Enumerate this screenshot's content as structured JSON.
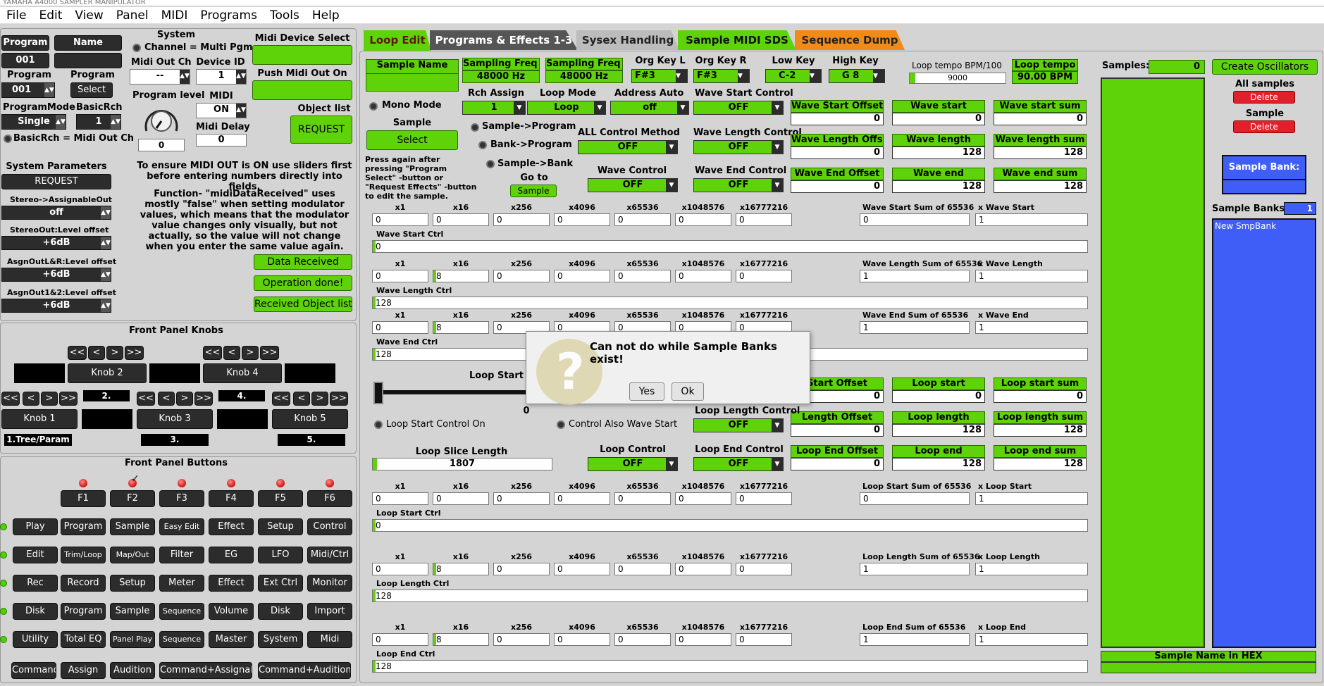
{
  "window_title": "YAMAHA A4000 SAMPLER MANIPULATOR",
  "menu": [
    "File",
    "Edit",
    "View",
    "Panel",
    "MIDI",
    "Programs",
    "Tools",
    "Help"
  ],
  "left": {
    "program_label": "Program",
    "program_value": "001",
    "name_label": "Name",
    "name_value": "",
    "program2_label": "Program",
    "program2_value": "001",
    "program_select_label": "Program",
    "select_button": "Select",
    "programmode_label": "ProgramMode",
    "programmode_value": "Single",
    "basicrch_label": "BasicRch",
    "basicrch_value": "1",
    "basicrch_radio": "BasicRch = Midi Out Ch",
    "system_label": "System",
    "channel_radio": "Channel = Multi Pgm",
    "midi_out_ch_label": "Midi Out Ch",
    "midi_out_ch_value": "--",
    "device_id_label": "Device ID",
    "device_id_value": "1",
    "program_level_label": "Program level",
    "program_level_value": "0",
    "midi_label": "MIDI",
    "midi_value": "ON",
    "midi_delay_label": "Midi Delay",
    "midi_delay_value": "0",
    "midi_device_select": "Midi Device Select",
    "push_midi_out": "Push Midi Out On",
    "object_list": "Object list",
    "request": "REQUEST",
    "system_params": "System Parameters",
    "request2": "REQUEST",
    "stereo_assign_label": "Stereo->AssignableOut",
    "stereo_assign_value": "off",
    "stereo_level_label": "StereoOut:Level offset",
    "stereo_level_value": "+6dB",
    "asgn_lr_label": "AsgnOutL&R:Level offset",
    "asgn_lr_value": "+6dB",
    "asgn_12_label": "AsgnOut1&2:Level offset",
    "asgn_12_value": "+6dB",
    "note1": "To ensure MIDI OUT is ON use sliders first before entering numbers directly into fields.",
    "note2": "Function- \"midiDataReceived\" uses mostly \"false\" when setting modulator values, which means that the modulator value changes only visually, but not actually, so the value will not change when you enter the same value again.",
    "data_received": "Data Received",
    "operation_done": "Operation done!",
    "received_object_list": "Received Object list"
  },
  "knobs": {
    "title": "Front Panel Knobs",
    "nav": [
      "<<",
      "<",
      ">",
      ">>"
    ],
    "knob2": "Knob 2",
    "knob4": "Knob 4",
    "knob1": "Knob 1",
    "knob3": "Knob 3",
    "knob5": "Knob 5",
    "l2": "2.",
    "l4": "4.",
    "l1": "1.Tree/Param",
    "l3": "3.",
    "l5": "5."
  },
  "buttons": {
    "title": "Front Panel Buttons",
    "f": [
      "F1",
      "F2",
      "F3",
      "F4",
      "F5",
      "F6"
    ],
    "rows": [
      [
        "Play",
        "Program",
        "Sample",
        "Easy Edit",
        "Effect",
        "Setup",
        "Control"
      ],
      [
        "Edit",
        "Trim/Loop",
        "Map/Out",
        "Filter",
        "EG",
        "LFO",
        "Midi/Ctrl"
      ],
      [
        "Rec",
        "Record",
        "Setup",
        "Meter",
        "Effect",
        "Ext Ctrl",
        "Monitor"
      ],
      [
        "Disk",
        "Program",
        "Sample",
        "Sequence",
        "Volume",
        "Disk",
        "Import"
      ],
      [
        "Utility",
        "Total EQ",
        "Panel Play",
        "Sequence",
        "Master",
        "System",
        "Midi"
      ]
    ],
    "bottom": [
      "Command",
      "Assign",
      "Audition",
      "Command+Assignable",
      "Command+Audition"
    ]
  },
  "tabs": [
    "Loop Edit",
    "Programs & Effects 1-3",
    "Sysex Handling",
    "Sample MIDI SDS",
    "Sequence Dump"
  ],
  "loop": {
    "sample_name": "Sample Name",
    "sf_l": "Sampling Freq L",
    "sf_l_v": "48000 Hz",
    "sf_r": "Sampling Freq R",
    "sf_r_v": "48000 Hz",
    "org_l": "Org Key L",
    "org_l_v": "F#3",
    "org_r": "Org Key R",
    "org_r_v": "F#3",
    "low_key": "Low Key",
    "low_key_v": "C-2",
    "high_key": "High Key",
    "high_key_v": "G 8",
    "tempo_bpm_label": "Loop tempo BPM/100",
    "tempo_bpm_v": "9000",
    "loop_tempo": "Loop tempo",
    "loop_tempo_v": "90.00 BPM",
    "mono_mode": "Mono Mode",
    "rch_assign": "Rch Assign",
    "rch_assign_v": "1",
    "loop_mode": "Loop Mode",
    "loop_mode_v": "Loop",
    "address_auto": "Address Auto",
    "address_auto_v": "off",
    "wsc": "Wave Start Control",
    "wsc_v": "OFF",
    "sample": "Sample",
    "select": "Select",
    "sample_program": "Sample->Program",
    "bank_program": "Bank->Program",
    "sample_bank": "Sample->Bank",
    "press_note": "Press again after pressing \"Program Select\" -button or \"Request Effects\" -button to edit the sample.",
    "go_to": "Go to",
    "go_sample": "Sample",
    "all_ctrl": "ALL Control Method",
    "all_ctrl_v": "OFF",
    "wlc": "Wave Length Control",
    "wlc_v": "OFF",
    "wave_control": "Wave Control",
    "wave_control_v": "OFF",
    "wec": "Wave End Control",
    "wec_v": "OFF",
    "boxes": [
      [
        "Wave Start Offset",
        "0"
      ],
      [
        "Wave start",
        "0"
      ],
      [
        "Wave start sum",
        "0"
      ],
      [
        "Wave Length Offset",
        "0"
      ],
      [
        "Wave length",
        "128"
      ],
      [
        "Wave length sum",
        "128"
      ],
      [
        "Wave End Offset",
        "0"
      ],
      [
        "Wave end",
        "128"
      ],
      [
        "Wave end sum",
        "128"
      ],
      [
        "Start Offset",
        "0"
      ],
      [
        "Loop start",
        "0"
      ],
      [
        "Loop start sum",
        "0"
      ],
      [
        "Length Offset",
        "0"
      ],
      [
        "Loop length",
        "128"
      ],
      [
        "Loop length sum",
        "128"
      ],
      [
        "Loop End Offset",
        "0"
      ],
      [
        "Loop end",
        "128"
      ],
      [
        "Loop end sum",
        "128"
      ]
    ],
    "mult": [
      "x1",
      "x16",
      "x256",
      "x4096",
      "x65536",
      "x1048576",
      "x16777216"
    ],
    "groups": [
      {
        "sum_label": "Wave Start Sum of 65536",
        "x_label": "x Wave Start",
        "vals": [
          "0",
          "0",
          "0",
          "0",
          "0",
          "0",
          "0"
        ],
        "sum": "0",
        "x": "1",
        "ctrl_label": "Wave Start Ctrl",
        "ctrl": "0"
      },
      {
        "sum_label": "Wave Length Sum of 65536",
        "x_label": "x Wave Length",
        "vals": [
          "0",
          "8",
          "0",
          "0",
          "0",
          "0",
          "0"
        ],
        "sum": "1",
        "x": "1",
        "ctrl_label": "Wave Length Ctrl",
        "ctrl": "128"
      },
      {
        "sum_label": "Wave End Sum of 65536",
        "x_label": "x Wave End",
        "vals": [
          "0",
          "8",
          "0",
          "0",
          "0",
          "0",
          "0"
        ],
        "sum": "1",
        "x": "1",
        "ctrl_label": "Wave End Ctrl",
        "ctrl": "128"
      },
      {
        "sum_label": "Loop Start Sum of 65536",
        "x_label": "x Loop Start",
        "vals": [
          "0",
          "0",
          "0",
          "0",
          "0",
          "0",
          "0"
        ],
        "sum": "0",
        "x": "1",
        "ctrl_label": "Loop Start Ctrl",
        "ctrl": "0"
      },
      {
        "sum_label": "Loop Length Sum of 65536",
        "x_label": "x Loop Length",
        "vals": [
          "0",
          "8",
          "0",
          "0",
          "0",
          "0",
          "0"
        ],
        "sum": "1",
        "x": "1",
        "ctrl_label": "Loop Length Ctrl",
        "ctrl": "128"
      },
      {
        "sum_label": "Loop End Sum of 65536",
        "x_label": "x Loop End",
        "vals": [
          "0",
          "8",
          "0",
          "0",
          "0",
          "0",
          "0"
        ],
        "sum": "1",
        "x": "1",
        "ctrl_label": "Loop End Ctrl",
        "ctrl": "128"
      }
    ],
    "loop_start_c": "Loop Start C",
    "slider_value": "0",
    "loop_start_control_on": "Loop Start Control On",
    "control_also_wave": "Control Also Wave Start",
    "llc": "Loop Length Control",
    "llc_v": "OFF",
    "loop_slice": "Loop Slice Length",
    "loop_slice_v": "1807",
    "loop_control": "Loop Control",
    "loop_control_v": "OFF",
    "lec": "Loop End Control",
    "lec_v": "OFF"
  },
  "right": {
    "samples_label": "Samples:",
    "samples_v": "0",
    "create_osc": "Create Oscillators",
    "all_samples": "All samples",
    "delete": "Delete",
    "sample": "Sample",
    "delete2": "Delete",
    "sample_bank": "Sample Bank:",
    "sample_banks_label": "Sample Banks:",
    "sample_banks_v": "1",
    "bank_item": "New SmpBank",
    "sample_name_hex": "Sample Name in HEX"
  },
  "dialog": {
    "message": "Can not do while Sample Banks exist!",
    "yes": "Yes",
    "ok": "Ok"
  },
  "colors": {
    "green": "#5fd30a",
    "blue": "#3f5ef7",
    "orange": "#f08a18",
    "dark": "#2c2c2c"
  }
}
